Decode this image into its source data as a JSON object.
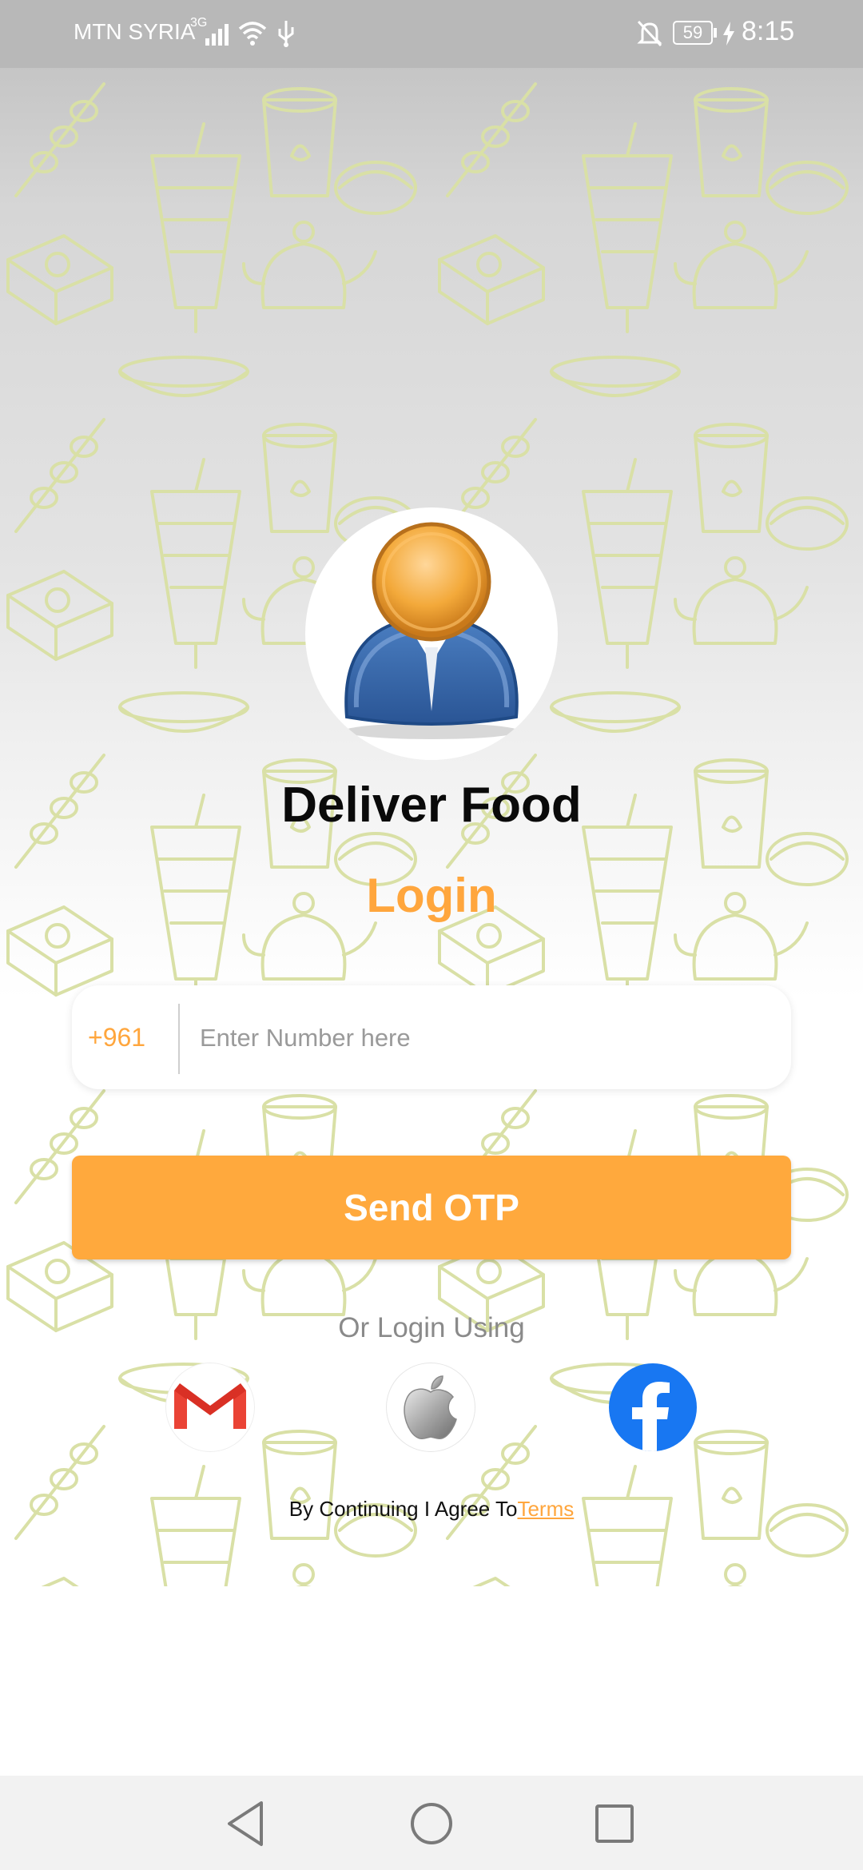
{
  "status_bar": {
    "carrier": "MTN SYRIA",
    "network_type": "3G",
    "battery_level": "59",
    "time": "8:15",
    "icons": [
      "signal-icon",
      "wifi-icon",
      "usb-icon",
      "notifications-off-icon",
      "battery-icon",
      "charging-icon"
    ]
  },
  "header": {
    "app_name": "Deliver Food",
    "screen_title": "Login"
  },
  "phone_form": {
    "country_code": "+961",
    "number_placeholder": "Enter Number here",
    "number_value": ""
  },
  "actions": {
    "send_otp_label": "Send OTP"
  },
  "social_login": {
    "caption": "Or Login Using",
    "providers": [
      "gmail-icon",
      "apple-icon",
      "facebook-icon"
    ]
  },
  "terms": {
    "prefix": "By Continuing I Agree To",
    "link_label": "Terms"
  },
  "nav_bar": {
    "icons": [
      "back-icon",
      "home-icon",
      "recents-icon"
    ]
  },
  "colors": {
    "accent": "#ffa93d",
    "facebook": "#1877f2",
    "gmail_red": "#ea4335"
  }
}
